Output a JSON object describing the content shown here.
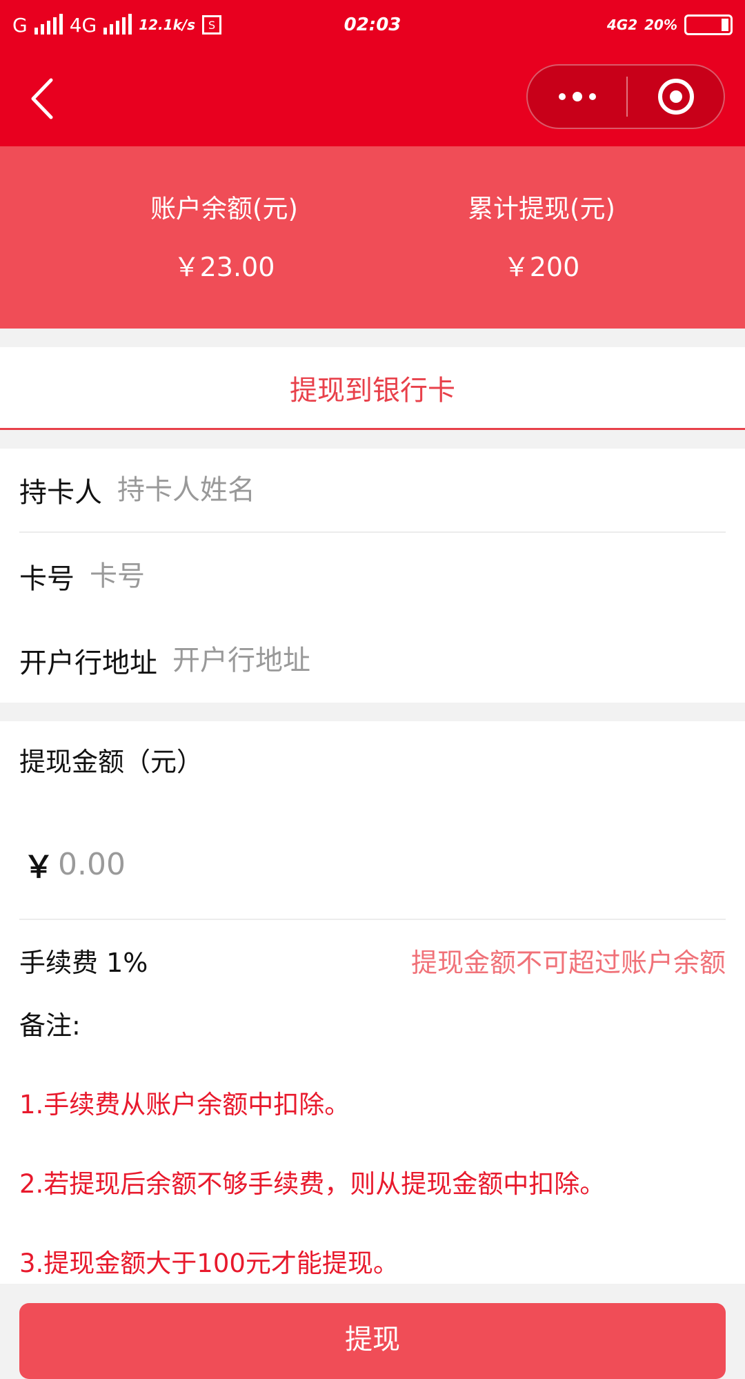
{
  "status_bar": {
    "network_1": "G",
    "network_2": "4G",
    "speed": "12.1k/s",
    "time": "02:03",
    "network_right": "4G2",
    "battery": "20%",
    "screenshot_icon_label": "S"
  },
  "nav": {
    "back_icon": "chevron-left-icon",
    "more_icon": "more-dots-icon",
    "close_icon": "target-close-icon"
  },
  "balance": {
    "account_label": "账户余额(元)",
    "account_value": "￥23.00",
    "total_label": "累计提现(元)",
    "total_value": "￥200"
  },
  "tab": {
    "label": "提现到银行卡"
  },
  "form": {
    "holder_label": "持卡人",
    "holder_placeholder": "持卡人姓名",
    "card_label": "卡号",
    "card_placeholder": "卡号",
    "bank_label": "开户行地址",
    "bank_placeholder": "开户行地址"
  },
  "amount": {
    "title": "提现金额（元）",
    "currency": "￥",
    "placeholder": "0.00",
    "fee_label": "手续费 1%",
    "warning": "提现金额不可超过账户余额"
  },
  "remarks": {
    "title": "备注:",
    "items": [
      "1.手续费从账户余额中扣除。",
      "2.若提现后余额不够手续费，则从提现金额中扣除。",
      "3.提现金额大于100元才能提现。"
    ]
  },
  "submit": {
    "label": "提现"
  },
  "colors": {
    "nav_red": "#e8001f",
    "panel_red": "#f04d57",
    "accent": "#e8404a",
    "note_red": "#e8192c",
    "warning_pink": "#f07178"
  }
}
